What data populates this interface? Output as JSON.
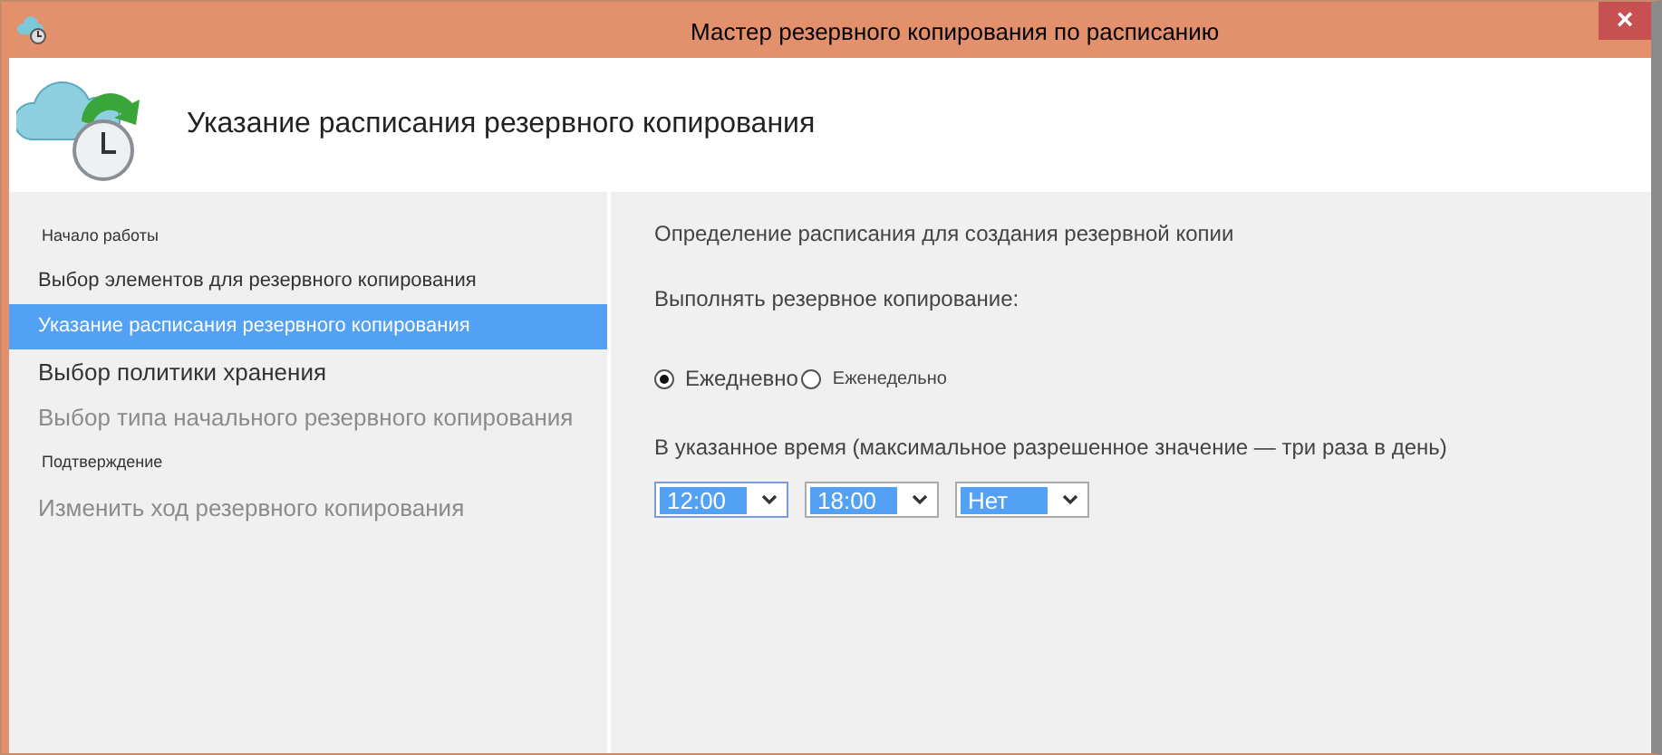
{
  "window": {
    "title": "Мастер  резервного копирования по расписанию",
    "close": "×"
  },
  "header": {
    "title": "Указание расписания резервного копирования"
  },
  "sidebar": {
    "items": [
      {
        "kind": "section",
        "label": "Начало работы",
        "selected": false,
        "disabled": false
      },
      {
        "kind": "step",
        "label": "Выбор элементов для резервного копирования",
        "selected": false,
        "disabled": false
      },
      {
        "kind": "step",
        "label": "Указание расписания резервного копирования",
        "selected": true,
        "disabled": false
      },
      {
        "kind": "step",
        "label": "Выбор политики хранения",
        "selected": false,
        "disabled": false
      },
      {
        "kind": "step",
        "label": "Выбор типа начального резервного копирования",
        "selected": false,
        "disabled": true
      },
      {
        "kind": "section",
        "label": "Подтверждение",
        "selected": false,
        "disabled": false
      },
      {
        "kind": "step",
        "label": "Изменить ход резервного копирования",
        "selected": false,
        "disabled": true
      }
    ]
  },
  "content": {
    "heading": "Определение расписания для создания резервной копии",
    "frequency_label": "Выполнять резервное копирование:",
    "frequency": [
      {
        "label": "Ежедневно",
        "selected": true
      },
      {
        "label": "Еженедельно",
        "selected": false
      }
    ],
    "times_label": "В указанное время (максимальное разрешенное значение — три раза в день)",
    "times": [
      {
        "value": "12:00",
        "focused": true
      },
      {
        "value": "18:00",
        "focused": false
      },
      {
        "value": "Нет",
        "focused": false
      }
    ]
  }
}
